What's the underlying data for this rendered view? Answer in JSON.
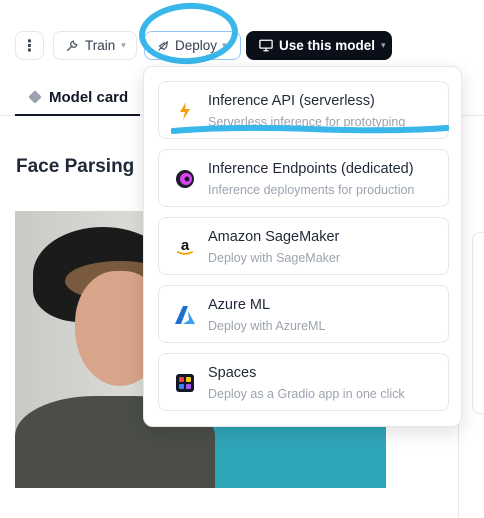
{
  "toolbar": {
    "more_label": "⋮",
    "train_label": "Train",
    "deploy_label": "Deploy",
    "use_model_label": "Use this model"
  },
  "tabs": {
    "model_card_label": "Model card"
  },
  "page": {
    "title": "Face Parsing"
  },
  "deploy_menu": {
    "items": [
      {
        "title": "Inference API (serverless)",
        "subtitle": "Serverless inference for prototyping",
        "icon": "lightning-icon"
      },
      {
        "title": "Inference Endpoints (dedicated)",
        "subtitle": "Inference deployments for production",
        "icon": "endpoints-icon"
      },
      {
        "title": "Amazon SageMaker",
        "subtitle": "Deploy with SageMaker",
        "icon": "amazon-icon"
      },
      {
        "title": "Azure ML",
        "subtitle": "Deploy with AzureML",
        "icon": "azure-icon"
      },
      {
        "title": "Spaces",
        "subtitle": "Deploy as a Gradio app in one click",
        "icon": "spaces-icon"
      }
    ]
  },
  "colors": {
    "annotation": "#39b6ea",
    "dark_button": "#0b0f19"
  }
}
